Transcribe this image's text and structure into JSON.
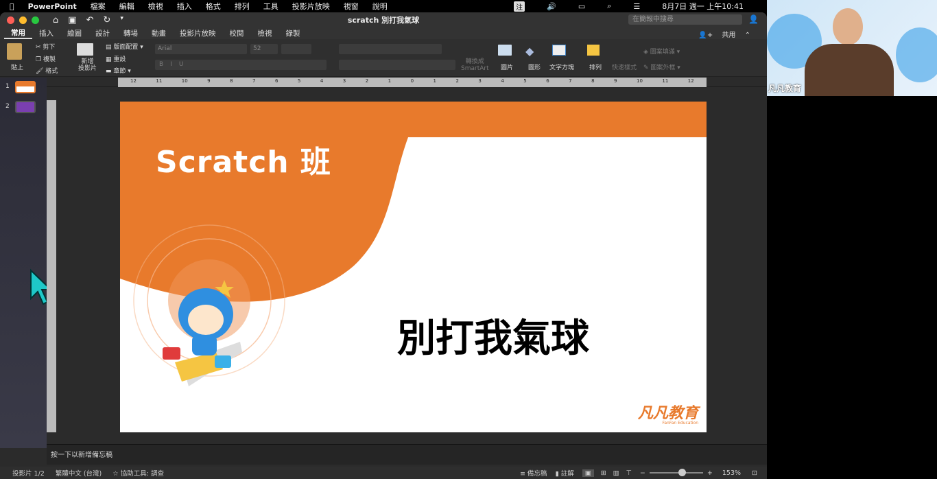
{
  "menubar": {
    "app": "PowerPoint",
    "items": [
      "檔案",
      "編輯",
      "檢視",
      "插入",
      "格式",
      "排列",
      "工具",
      "投影片放映",
      "視窗",
      "說明"
    ],
    "ime": "注",
    "datetime": "8月7日 週一 上午10:41"
  },
  "window": {
    "title": "scratch 別打我氣球",
    "search_placeholder": "在簡報中搜尋",
    "share": "共用"
  },
  "tabs": [
    "常用",
    "插入",
    "繪圖",
    "設計",
    "轉場",
    "動畫",
    "投影片放映",
    "校閱",
    "檢視",
    "錄製"
  ],
  "ribbon": {
    "paste": "貼上",
    "cut": "剪下",
    "copy": "複製",
    "format": "格式",
    "new_slide": "新增\n投影片",
    "layout": "版面配置",
    "reset": "重設",
    "section": "章節",
    "font": "Arial",
    "size": "52",
    "smartart": "轉換成\nSmartArt",
    "picture": "圖片",
    "shape": "圖形",
    "textbox": "文字方塊",
    "arrange": "排列",
    "quick_styles": "快速樣式",
    "fill": "圖案填滿",
    "outline": "圖案外框"
  },
  "ruler_labels": [
    "12",
    "11",
    "10",
    "9",
    "8",
    "7",
    "6",
    "5",
    "4",
    "3",
    "2",
    "1",
    "0",
    "1",
    "2",
    "3",
    "4",
    "5",
    "6",
    "7",
    "8",
    "9",
    "10",
    "11",
    "12"
  ],
  "slides": [
    {
      "num": "1"
    },
    {
      "num": "2"
    }
  ],
  "slide": {
    "heading": "Scratch 班",
    "title": "別打我氣球",
    "logo": "凡凡教育",
    "logo_sub": "FanFan Education"
  },
  "notes_placeholder": "按一下以新增備忘稿",
  "status": {
    "slide": "投影片 1/2",
    "lang": "繁體中文 (台灣)",
    "access": "協助工具: 調查",
    "notes": "備忘稿",
    "comments": "註解",
    "zoom": "153%",
    "zoom_fraction": 0.6
  },
  "webcam": {
    "name": "凡凡教育"
  },
  "colors": {
    "accent": "#e87a2c"
  }
}
